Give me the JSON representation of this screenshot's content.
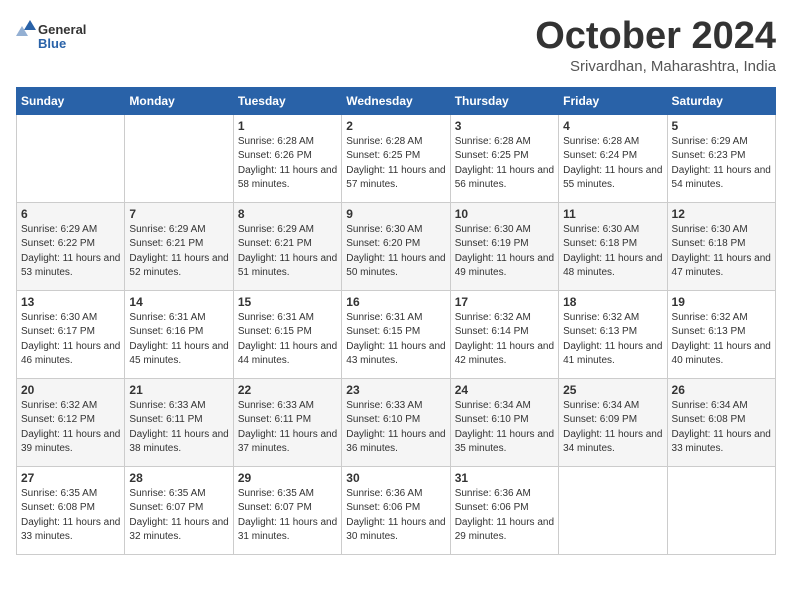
{
  "logo": {
    "general": "General",
    "blue": "Blue"
  },
  "title": {
    "month": "October 2024",
    "location": "Srivardhan, Maharashtra, India"
  },
  "days_header": [
    "Sunday",
    "Monday",
    "Tuesday",
    "Wednesday",
    "Thursday",
    "Friday",
    "Saturday"
  ],
  "weeks": [
    [
      {
        "day": "",
        "sunrise": "",
        "sunset": "",
        "daylight": ""
      },
      {
        "day": "",
        "sunrise": "",
        "sunset": "",
        "daylight": ""
      },
      {
        "day": "1",
        "sunrise": "Sunrise: 6:28 AM",
        "sunset": "Sunset: 6:26 PM",
        "daylight": "Daylight: 11 hours and 58 minutes."
      },
      {
        "day": "2",
        "sunrise": "Sunrise: 6:28 AM",
        "sunset": "Sunset: 6:25 PM",
        "daylight": "Daylight: 11 hours and 57 minutes."
      },
      {
        "day": "3",
        "sunrise": "Sunrise: 6:28 AM",
        "sunset": "Sunset: 6:25 PM",
        "daylight": "Daylight: 11 hours and 56 minutes."
      },
      {
        "day": "4",
        "sunrise": "Sunrise: 6:28 AM",
        "sunset": "Sunset: 6:24 PM",
        "daylight": "Daylight: 11 hours and 55 minutes."
      },
      {
        "day": "5",
        "sunrise": "Sunrise: 6:29 AM",
        "sunset": "Sunset: 6:23 PM",
        "daylight": "Daylight: 11 hours and 54 minutes."
      }
    ],
    [
      {
        "day": "6",
        "sunrise": "Sunrise: 6:29 AM",
        "sunset": "Sunset: 6:22 PM",
        "daylight": "Daylight: 11 hours and 53 minutes."
      },
      {
        "day": "7",
        "sunrise": "Sunrise: 6:29 AM",
        "sunset": "Sunset: 6:21 PM",
        "daylight": "Daylight: 11 hours and 52 minutes."
      },
      {
        "day": "8",
        "sunrise": "Sunrise: 6:29 AM",
        "sunset": "Sunset: 6:21 PM",
        "daylight": "Daylight: 11 hours and 51 minutes."
      },
      {
        "day": "9",
        "sunrise": "Sunrise: 6:30 AM",
        "sunset": "Sunset: 6:20 PM",
        "daylight": "Daylight: 11 hours and 50 minutes."
      },
      {
        "day": "10",
        "sunrise": "Sunrise: 6:30 AM",
        "sunset": "Sunset: 6:19 PM",
        "daylight": "Daylight: 11 hours and 49 minutes."
      },
      {
        "day": "11",
        "sunrise": "Sunrise: 6:30 AM",
        "sunset": "Sunset: 6:18 PM",
        "daylight": "Daylight: 11 hours and 48 minutes."
      },
      {
        "day": "12",
        "sunrise": "Sunrise: 6:30 AM",
        "sunset": "Sunset: 6:18 PM",
        "daylight": "Daylight: 11 hours and 47 minutes."
      }
    ],
    [
      {
        "day": "13",
        "sunrise": "Sunrise: 6:30 AM",
        "sunset": "Sunset: 6:17 PM",
        "daylight": "Daylight: 11 hours and 46 minutes."
      },
      {
        "day": "14",
        "sunrise": "Sunrise: 6:31 AM",
        "sunset": "Sunset: 6:16 PM",
        "daylight": "Daylight: 11 hours and 45 minutes."
      },
      {
        "day": "15",
        "sunrise": "Sunrise: 6:31 AM",
        "sunset": "Sunset: 6:15 PM",
        "daylight": "Daylight: 11 hours and 44 minutes."
      },
      {
        "day": "16",
        "sunrise": "Sunrise: 6:31 AM",
        "sunset": "Sunset: 6:15 PM",
        "daylight": "Daylight: 11 hours and 43 minutes."
      },
      {
        "day": "17",
        "sunrise": "Sunrise: 6:32 AM",
        "sunset": "Sunset: 6:14 PM",
        "daylight": "Daylight: 11 hours and 42 minutes."
      },
      {
        "day": "18",
        "sunrise": "Sunrise: 6:32 AM",
        "sunset": "Sunset: 6:13 PM",
        "daylight": "Daylight: 11 hours and 41 minutes."
      },
      {
        "day": "19",
        "sunrise": "Sunrise: 6:32 AM",
        "sunset": "Sunset: 6:13 PM",
        "daylight": "Daylight: 11 hours and 40 minutes."
      }
    ],
    [
      {
        "day": "20",
        "sunrise": "Sunrise: 6:32 AM",
        "sunset": "Sunset: 6:12 PM",
        "daylight": "Daylight: 11 hours and 39 minutes."
      },
      {
        "day": "21",
        "sunrise": "Sunrise: 6:33 AM",
        "sunset": "Sunset: 6:11 PM",
        "daylight": "Daylight: 11 hours and 38 minutes."
      },
      {
        "day": "22",
        "sunrise": "Sunrise: 6:33 AM",
        "sunset": "Sunset: 6:11 PM",
        "daylight": "Daylight: 11 hours and 37 minutes."
      },
      {
        "day": "23",
        "sunrise": "Sunrise: 6:33 AM",
        "sunset": "Sunset: 6:10 PM",
        "daylight": "Daylight: 11 hours and 36 minutes."
      },
      {
        "day": "24",
        "sunrise": "Sunrise: 6:34 AM",
        "sunset": "Sunset: 6:10 PM",
        "daylight": "Daylight: 11 hours and 35 minutes."
      },
      {
        "day": "25",
        "sunrise": "Sunrise: 6:34 AM",
        "sunset": "Sunset: 6:09 PM",
        "daylight": "Daylight: 11 hours and 34 minutes."
      },
      {
        "day": "26",
        "sunrise": "Sunrise: 6:34 AM",
        "sunset": "Sunset: 6:08 PM",
        "daylight": "Daylight: 11 hours and 33 minutes."
      }
    ],
    [
      {
        "day": "27",
        "sunrise": "Sunrise: 6:35 AM",
        "sunset": "Sunset: 6:08 PM",
        "daylight": "Daylight: 11 hours and 33 minutes."
      },
      {
        "day": "28",
        "sunrise": "Sunrise: 6:35 AM",
        "sunset": "Sunset: 6:07 PM",
        "daylight": "Daylight: 11 hours and 32 minutes."
      },
      {
        "day": "29",
        "sunrise": "Sunrise: 6:35 AM",
        "sunset": "Sunset: 6:07 PM",
        "daylight": "Daylight: 11 hours and 31 minutes."
      },
      {
        "day": "30",
        "sunrise": "Sunrise: 6:36 AM",
        "sunset": "Sunset: 6:06 PM",
        "daylight": "Daylight: 11 hours and 30 minutes."
      },
      {
        "day": "31",
        "sunrise": "Sunrise: 6:36 AM",
        "sunset": "Sunset: 6:06 PM",
        "daylight": "Daylight: 11 hours and 29 minutes."
      },
      {
        "day": "",
        "sunrise": "",
        "sunset": "",
        "daylight": ""
      },
      {
        "day": "",
        "sunrise": "",
        "sunset": "",
        "daylight": ""
      }
    ]
  ]
}
